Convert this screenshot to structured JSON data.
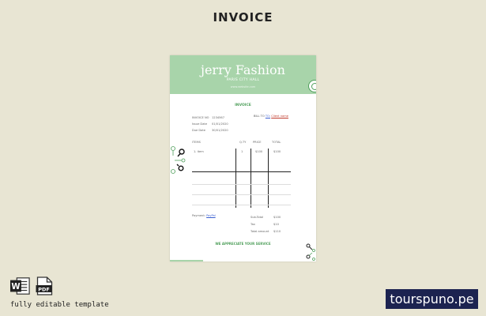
{
  "page": {
    "heading": "INVOICE"
  },
  "invoice": {
    "brand": "jerry Fashion",
    "address": "PARIS CITY HALL",
    "website": "www.website.com",
    "title": "INVOICE",
    "meta": [
      {
        "label": "INVOICE NO",
        "value": "1234567"
      },
      {
        "label": "Issue Date",
        "value": "01/01/2020"
      },
      {
        "label": "Due Date",
        "value": "30/01/2020"
      }
    ],
    "bill_label": "BILL TO",
    "bill_to": "TO:",
    "bill_name": "Client name",
    "columns": [
      "ITEMS",
      "Q.TY",
      "PRICE",
      "TOTAL"
    ],
    "rows": [
      {
        "item": "1. item",
        "qty": "1",
        "price": "$100",
        "total": "$100"
      }
    ],
    "payment_label": "Payment:",
    "payment_method": "PayPal",
    "totals": [
      {
        "label": "Sub-Total",
        "value": "$100"
      },
      {
        "label": "Tax",
        "value": "$10"
      },
      {
        "label": "Total amount",
        "value": "$110"
      }
    ],
    "thanks": "WE APPRECIATE YOUR SERVICE"
  },
  "footer": {
    "caption": "fully editable template",
    "word_icon_text": "W",
    "pdf_icon_text": "PDF",
    "site": "tourspuno.pe"
  },
  "colors": {
    "accent": "#a8d4aa",
    "accent_dark": "#4f9f5b",
    "background": "#e8e5d3",
    "badge": "#1c2350"
  }
}
